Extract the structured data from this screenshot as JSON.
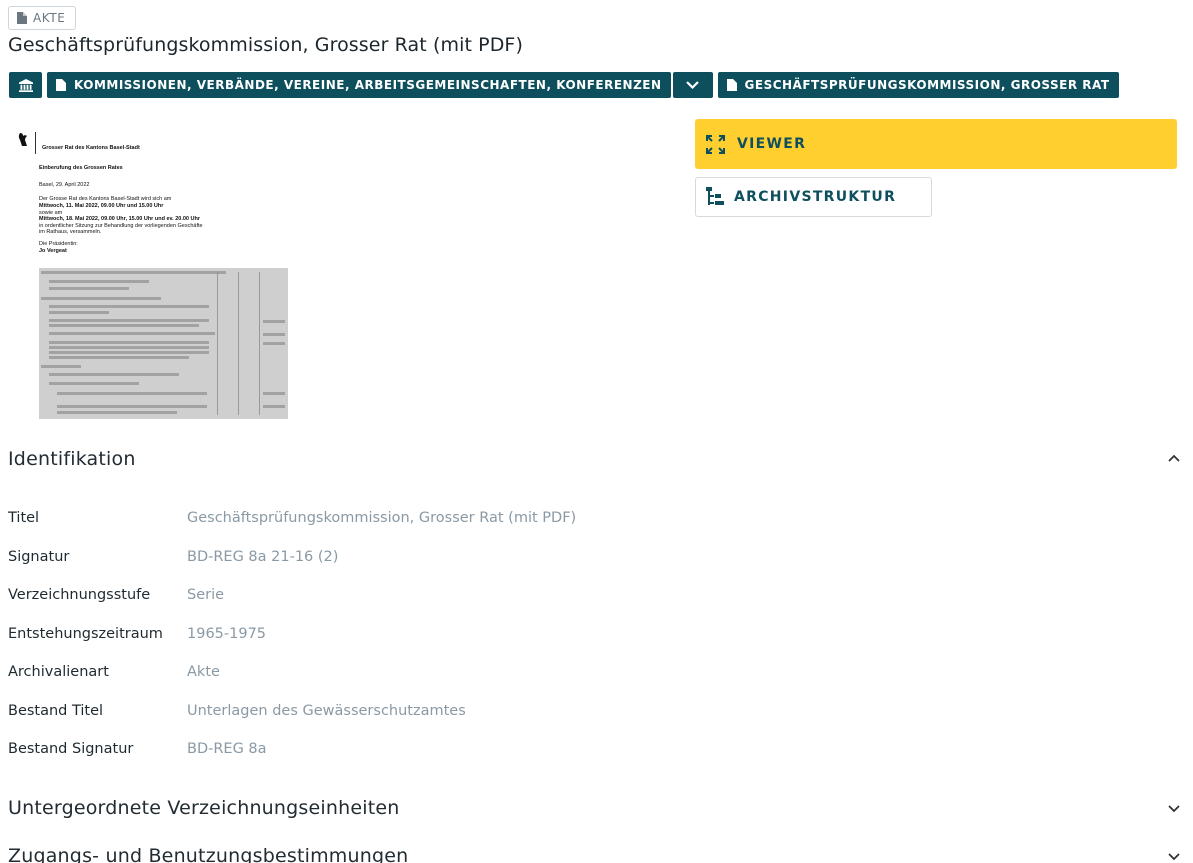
{
  "badge": {
    "label": "AKTE",
    "icon": "document-icon"
  },
  "title": "Geschäftsprüfungskommission, Grosser Rat (mit PDF)",
  "breadcrumbs": {
    "home_icon": "institution-icon",
    "items": [
      {
        "label": "KOMMISSIONEN, VERBÄNDE, VEREINE, ARBEITSGEMEINSCHAFTEN, KONFERENZEN",
        "icon": "document-icon"
      },
      {
        "label": "GESCHÄFTSPRÜFUNGSKOMMISSION, GROSSER RAT",
        "icon": "document-icon"
      }
    ],
    "toggle_icon": "chevron-down-icon"
  },
  "preview": {
    "org": "Grosser Rat des Kantons Basel-Stadt",
    "heading": "Einberufung des Grossen Rates",
    "date": "Basel, 29. April 2022",
    "lines": [
      "Der Grosse Rat des Kantons Basel-Stadt wird sich am",
      "Mittwoch, 11. Mai 2022, 09.00 Uhr und 15.00 Uhr",
      "sowie am",
      "Mittwoch, 18. Mai 2022, 09.00 Uhr, 15.00 Uhr und ev. 20.00 Uhr",
      "in ordentlicher Sitzung zur Behandlung der vorliegenden Geschäfte",
      "im Rathaus, versammeln."
    ],
    "signoff_label": "Die Präsidentin:",
    "signoff_name": "Jo Vergeat"
  },
  "actions": {
    "viewer_label": "VIEWER",
    "viewer_icon": "expand-icon",
    "archiv_label": "ARCHIVSTRUKTUR",
    "archiv_icon": "tree-structure-icon",
    "viewer_color": "#ffcf2f",
    "brand_color": "#0e4f5e"
  },
  "identifikation": {
    "heading": "Identifikation",
    "rows": [
      {
        "label": "Titel",
        "value": "Geschäftsprüfungskommission, Grosser Rat (mit PDF)"
      },
      {
        "label": "Signatur",
        "value": "BD-REG 8a 21-16 (2)"
      },
      {
        "label": "Verzeichnungsstufe",
        "value": "Serie"
      },
      {
        "label": "Entstehungszeitraum",
        "value": "1965-1975"
      },
      {
        "label": "Archivalienart",
        "value": "Akte"
      },
      {
        "label": "Bestand Titel",
        "value": "Unterlagen des Gewässerschutzamtes"
      },
      {
        "label": "Bestand Signatur",
        "value": "BD-REG 8a"
      }
    ]
  },
  "sections": {
    "untergeordnete": "Untergeordnete Verzeichnungseinheiten",
    "zugang": "Zugangs- und Benutzungsbestimmungen"
  }
}
